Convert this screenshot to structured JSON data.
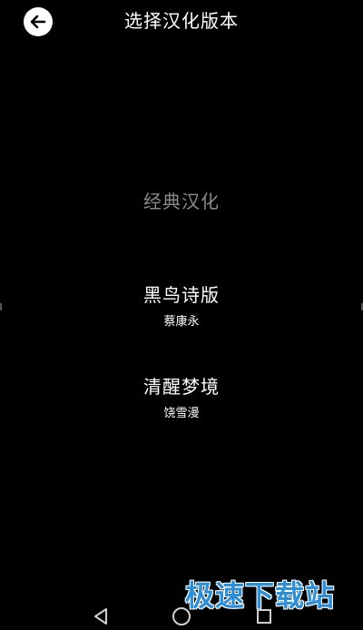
{
  "header": {
    "title": "选择汉化版本",
    "back_icon": "arrow-left-icon"
  },
  "options": [
    {
      "title": "经典汉化",
      "subtitle": "",
      "state": "dimmed"
    },
    {
      "title": "黑鸟诗版",
      "subtitle": "蔡康永",
      "state": "normal"
    },
    {
      "title": "清醒梦境",
      "subtitle": "饶雪漫",
      "state": "normal"
    }
  ],
  "watermark": {
    "text": "极速下载站",
    "color": "#2f8fd6"
  },
  "navbar": {
    "back_icon": "triangle-back-icon",
    "home_icon": "circle-home-icon",
    "recent_icon": "square-recent-icon"
  },
  "colors": {
    "background": "#000000",
    "text": "#ffffff",
    "dimmed_text": "#8a8a8a"
  }
}
